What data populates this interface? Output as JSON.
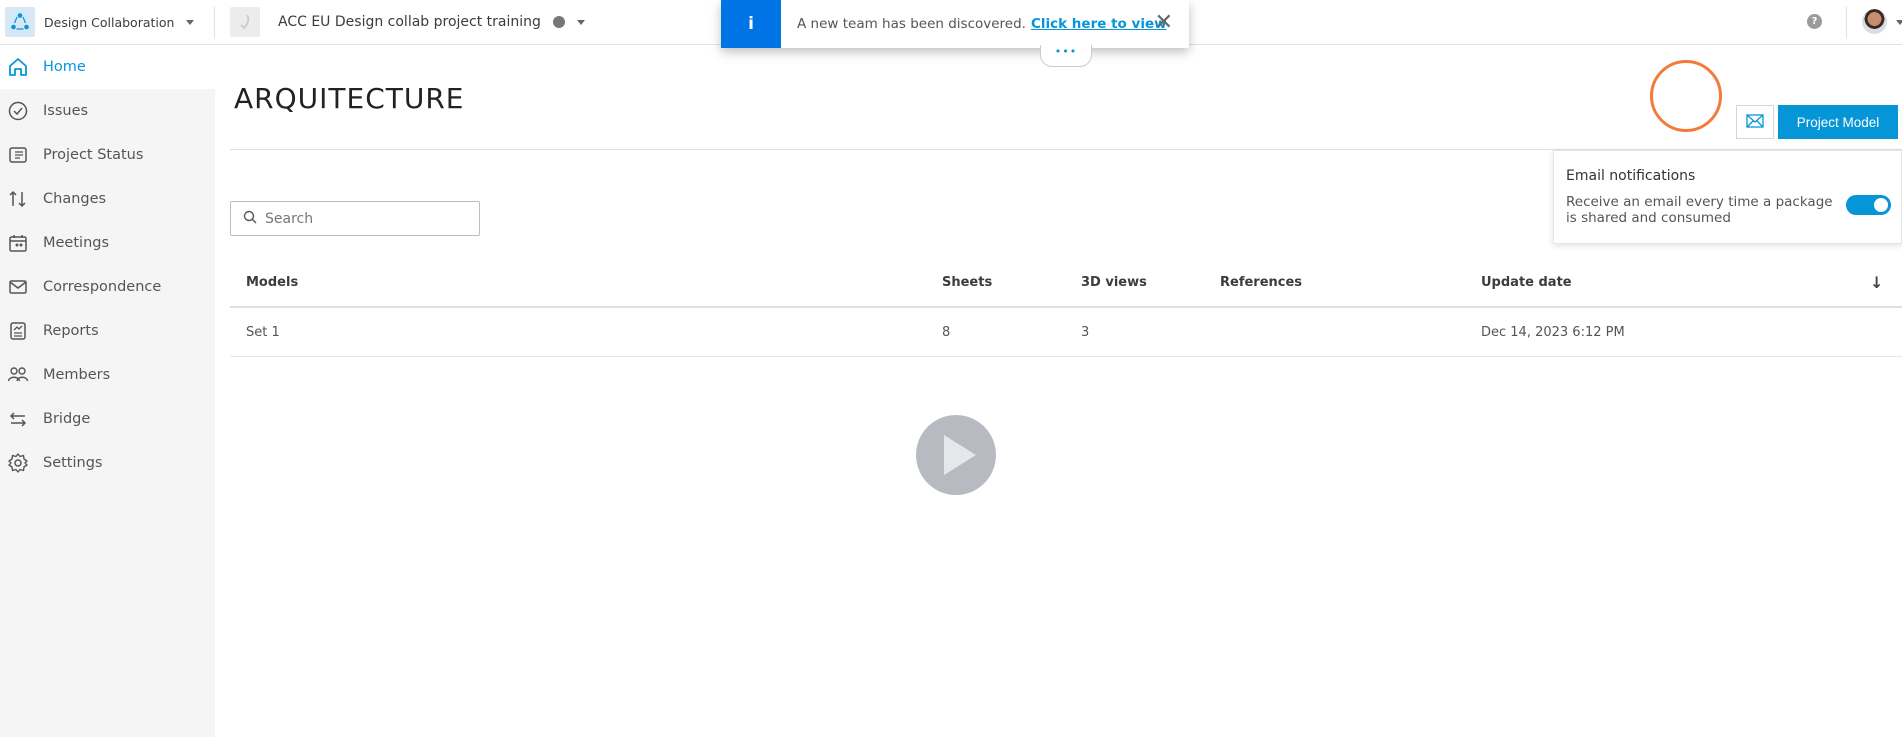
{
  "topbar": {
    "app_name": "Design Collaboration",
    "project_name": "ACC EU Design collab project training",
    "help_label": "?"
  },
  "banner": {
    "icon": "i",
    "message": "A new team has been discovered.",
    "link": "Click here to view",
    "close": "✕",
    "more": "•••"
  },
  "sidebar": {
    "items": [
      {
        "label": "Home",
        "icon": "home-icon",
        "active": true
      },
      {
        "label": "Issues",
        "icon": "check-circle-icon"
      },
      {
        "label": "Project Status",
        "icon": "project-status-icon"
      },
      {
        "label": "Changes",
        "icon": "changes-arrows-icon"
      },
      {
        "label": "Meetings",
        "icon": "meetings-calendar-icon"
      },
      {
        "label": "Correspondence",
        "icon": "envelope-icon"
      },
      {
        "label": "Reports",
        "icon": "reports-icon"
      },
      {
        "label": "Members",
        "icon": "members-icon"
      },
      {
        "label": "Bridge",
        "icon": "bridge-arrows-icon"
      },
      {
        "label": "Settings",
        "icon": "gear-icon"
      }
    ]
  },
  "main": {
    "title": "ARQUITECTURE",
    "project_model_button": "Project Model",
    "search_placeholder": "Search",
    "table": {
      "columns": [
        "Models",
        "Sheets",
        "3D views",
        "References",
        "Update date"
      ],
      "rows": [
        {
          "model": "Set 1",
          "sheets": "8",
          "views3d": "3",
          "references": "",
          "update_date": "Dec 14, 2023 6:12 PM"
        }
      ],
      "sort_icon": "↓"
    }
  },
  "popover": {
    "title": "Email notifications",
    "text": "Receive an email every time a package is shared and consumed",
    "toggle_on": true
  },
  "colors": {
    "accent": "#0696d7",
    "banner_icon_bg": "#0073e6",
    "cursor_ring": "#f37b3a"
  }
}
